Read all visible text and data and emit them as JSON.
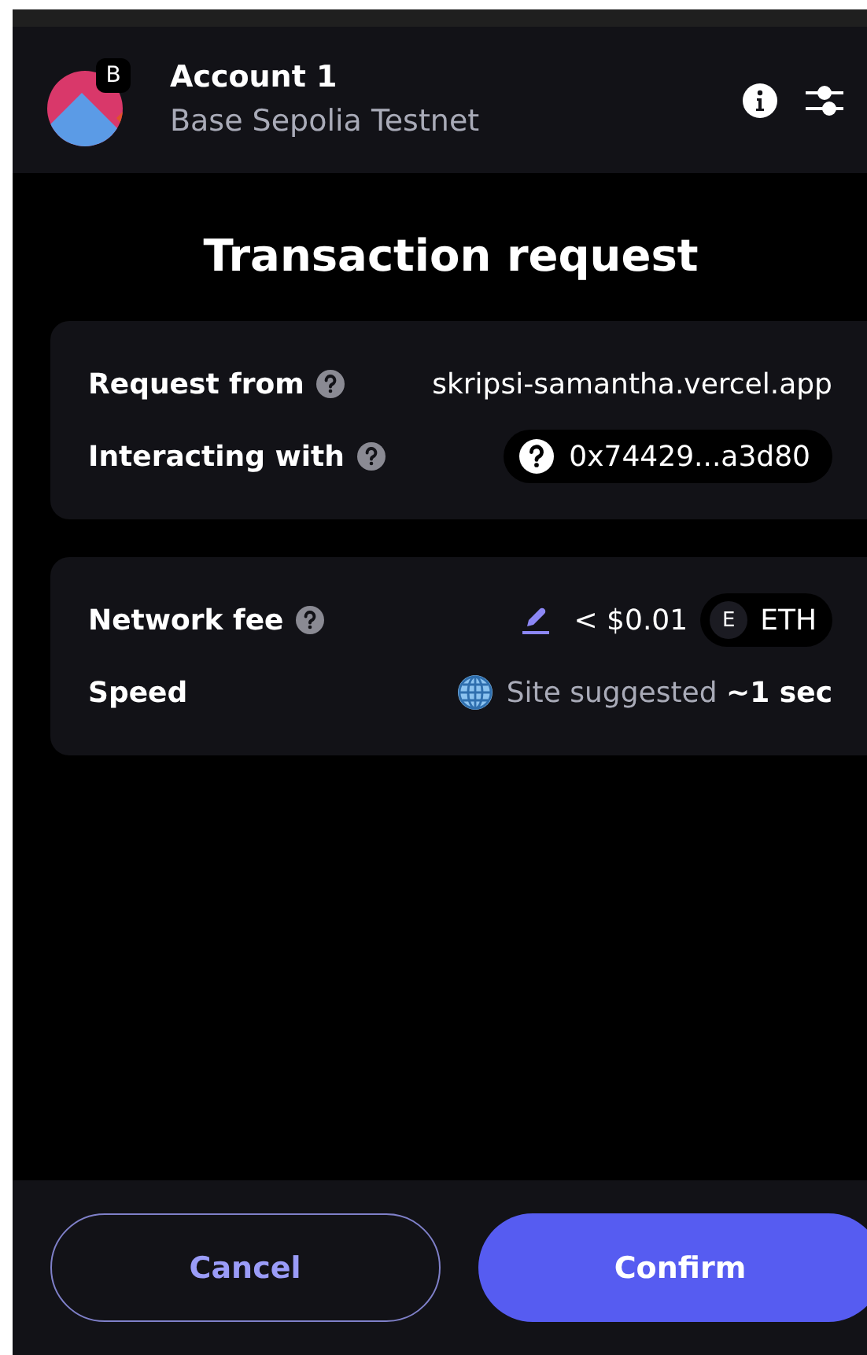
{
  "account": {
    "name": "Account 1",
    "network": "Base Sepolia Testnet",
    "network_badge": "B"
  },
  "title": "Transaction request",
  "sections": [
    {
      "rows": [
        {
          "kind": "text",
          "label": "Request from",
          "help": true,
          "value": "skripsi-samantha.vercel.app"
        },
        {
          "kind": "address",
          "label": "Interacting with",
          "help": true,
          "value": "0x74429...a3d80"
        }
      ]
    },
    {
      "rows": [
        {
          "kind": "fee",
          "label": "Network fee",
          "help": true,
          "value": "< $0.01",
          "token_badge": "E",
          "token": "ETH"
        },
        {
          "kind": "speed",
          "label": "Speed",
          "help": false,
          "value": "Site suggested",
          "detail": "~1 sec"
        }
      ]
    }
  ],
  "buttons": [
    {
      "label": "Cancel",
      "kind": "secondary"
    },
    {
      "label": "Confirm",
      "kind": "primary"
    }
  ]
}
